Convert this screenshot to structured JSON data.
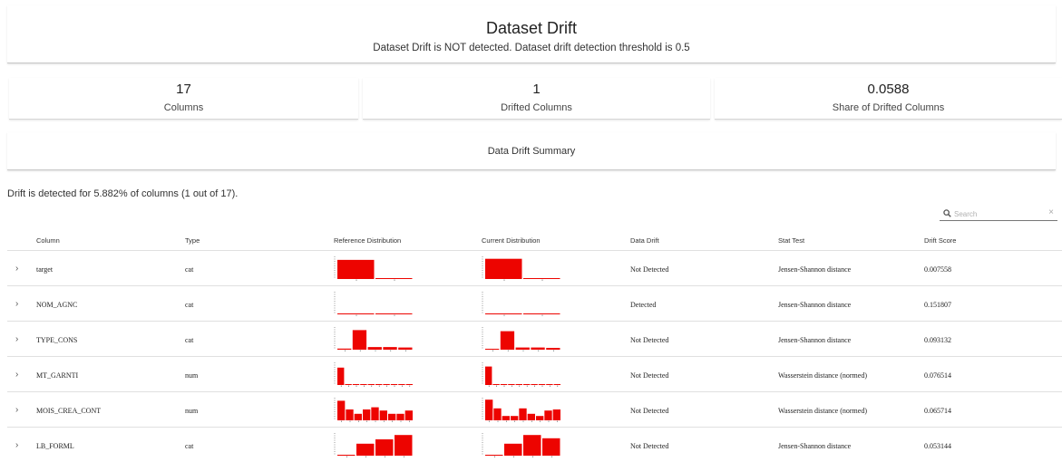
{
  "header": {
    "title": "Dataset Drift",
    "subtitle": "Dataset Drift is NOT detected. Dataset drift detection threshold is 0.5"
  },
  "counters": [
    {
      "value": "17",
      "label": "Columns"
    },
    {
      "value": "1",
      "label": "Drifted Columns"
    },
    {
      "value": "0.0588",
      "label": "Share of Drifted Columns"
    }
  ],
  "summary_title": "Data Drift Summary",
  "detected_note": "Drift is detected for 5.882% of columns (1 out of 17).",
  "search": {
    "placeholder": "Search",
    "clear": "×",
    "icon": "search-icon"
  },
  "table": {
    "headers": [
      "Column",
      "Type",
      "Reference Distribution",
      "Current Distribution",
      "Data Drift",
      "Stat Test",
      "Drift Score"
    ],
    "rows": [
      {
        "column": "target",
        "type": "cat",
        "data_drift": "Not Detected",
        "stat_test": "Jensen-Shannon distance",
        "drift_score": "0.007558",
        "ref_hist": [
          0.88,
          0.03
        ],
        "cur_hist": [
          0.93,
          0.04
        ]
      },
      {
        "column": "NOM_AGNC",
        "type": "cat",
        "data_drift": "Detected",
        "stat_test": "Jensen-Shannon distance",
        "drift_score": "0.151807",
        "ref_hist": [
          0.01,
          0.01
        ],
        "cur_hist": [
          0.01,
          0.01
        ]
      },
      {
        "column": "TYPE_CONS",
        "type": "cat",
        "data_drift": "Not Detected",
        "stat_test": "Jensen-Shannon distance",
        "drift_score": "0.093132",
        "ref_hist": [
          0.05,
          0.9,
          0.12,
          0.12,
          0.1
        ],
        "cur_hist": [
          0.03,
          0.85,
          0.1,
          0.1,
          0.08
        ]
      },
      {
        "column": "MT_GARNTI",
        "type": "num",
        "data_drift": "Not Detected",
        "stat_test": "Wasserstein distance (normed)",
        "drift_score": "0.076514",
        "ref_hist": [
          0.8,
          0.04,
          0.02,
          0.02,
          0.01,
          0.01,
          0.01,
          0.01,
          0.01,
          0.01
        ],
        "cur_hist": [
          0.85,
          0.03,
          0.02,
          0.01,
          0.01,
          0.01,
          0.01,
          0.01,
          0.01,
          0.01
        ]
      },
      {
        "column": "MOIS_CREA_CONT",
        "type": "num",
        "data_drift": "Not Detected",
        "stat_test": "Wasserstein distance (normed)",
        "drift_score": "0.065714",
        "ref_hist": [
          0.9,
          0.5,
          0.3,
          0.5,
          0.6,
          0.45,
          0.3,
          0.3,
          0.45
        ],
        "cur_hist": [
          0.95,
          0.55,
          0.2,
          0.2,
          0.55,
          0.3,
          0.2,
          0.45,
          0.5
        ]
      },
      {
        "column": "LB_FORML",
        "type": "cat",
        "data_drift": "Not Detected",
        "stat_test": "Jensen-Shannon distance",
        "drift_score": "0.053144",
        "ref_hist": [
          0.02,
          0.55,
          0.75,
          0.95
        ],
        "cur_hist": [
          0.02,
          0.55,
          0.95,
          0.8
        ]
      }
    ]
  },
  "colors": {
    "bar": "#ed0400",
    "axis": "#555555"
  }
}
